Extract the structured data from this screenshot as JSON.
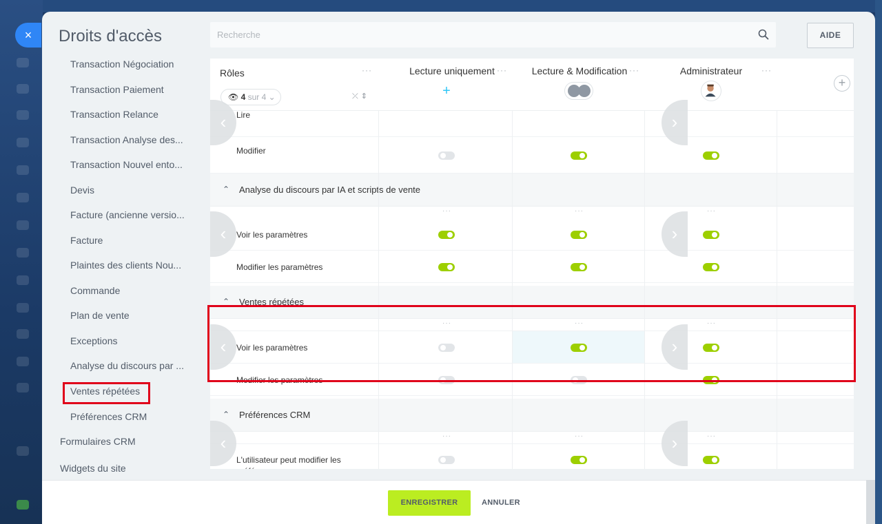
{
  "window": {
    "title": "Droits d'accès",
    "close_label": "×"
  },
  "search": {
    "placeholder": "Recherche"
  },
  "help_button": "AIDE",
  "sidebar": {
    "items": [
      {
        "label": "Transaction Négociation",
        "level": "sub"
      },
      {
        "label": "Transaction Paiement",
        "level": "sub"
      },
      {
        "label": "Transaction Relance",
        "level": "sub"
      },
      {
        "label": "Transaction Analyse des...",
        "level": "sub"
      },
      {
        "label": "Transaction Nouvel ento...",
        "level": "sub"
      },
      {
        "label": "Devis",
        "level": "sub"
      },
      {
        "label": "Facture (ancienne versio...",
        "level": "sub"
      },
      {
        "label": "Facture",
        "level": "sub"
      },
      {
        "label": "Plaintes des clients Nou...",
        "level": "sub"
      },
      {
        "label": "Commande",
        "level": "sub"
      },
      {
        "label": "Plan de vente",
        "level": "sub"
      },
      {
        "label": "Exceptions",
        "level": "sub"
      },
      {
        "label": "Analyse du discours par ...",
        "level": "sub"
      },
      {
        "label": "Ventes répétées",
        "level": "sub",
        "selected": true
      },
      {
        "label": "Préférences CRM",
        "level": "sub"
      },
      {
        "label": "Formulaires CRM",
        "level": "top"
      },
      {
        "label": "Widgets du site",
        "level": "top"
      }
    ]
  },
  "table": {
    "roles_label": "Rôles",
    "menu_dots": "···",
    "counter": {
      "icon": "eye-icon",
      "shown": "4",
      "of_text": "sur 4"
    },
    "columns": [
      {
        "name": "Lecture uniquement",
        "member_icon": "add-member-icon"
      },
      {
        "name": "Lecture & Modification",
        "member_icon": "group-avatar-icon"
      },
      {
        "name": "Administrateur",
        "member_icon": "user-avatar-icon"
      }
    ],
    "partial_row": {
      "label": "Lire"
    },
    "sections": [
      {
        "title": "",
        "rows": [
          {
            "label": "Modifier",
            "values": [
              false,
              true,
              true
            ]
          }
        ]
      },
      {
        "title": "Analyse du discours par IA et scripts de vente",
        "rows": [
          {
            "label": "Voir les paramètres",
            "values": [
              true,
              true,
              true
            ]
          },
          {
            "label": "Modifier les paramètres",
            "values": [
              true,
              true,
              true
            ]
          }
        ]
      },
      {
        "title": "Ventes répétées",
        "rows": [
          {
            "label": "Voir les paramètres",
            "values": [
              false,
              true,
              true
            ]
          },
          {
            "label": "Modifier les paramètres",
            "values": [
              false,
              false,
              true
            ]
          }
        ]
      },
      {
        "title": "Préférences CRM",
        "rows": [
          {
            "label": "L'utilisateur peut modifier les préférences",
            "values": [
              false,
              true,
              true
            ]
          }
        ]
      }
    ]
  },
  "footer": {
    "save_label": "ENREGISTRER",
    "cancel_label": "ANNULER"
  },
  "colors": {
    "toggle_on": "#9dcf00",
    "toggle_off": "#e2e5e8",
    "save_button": "#bbed21",
    "highlight": "#e0001a",
    "accent": "#2f86f6"
  }
}
